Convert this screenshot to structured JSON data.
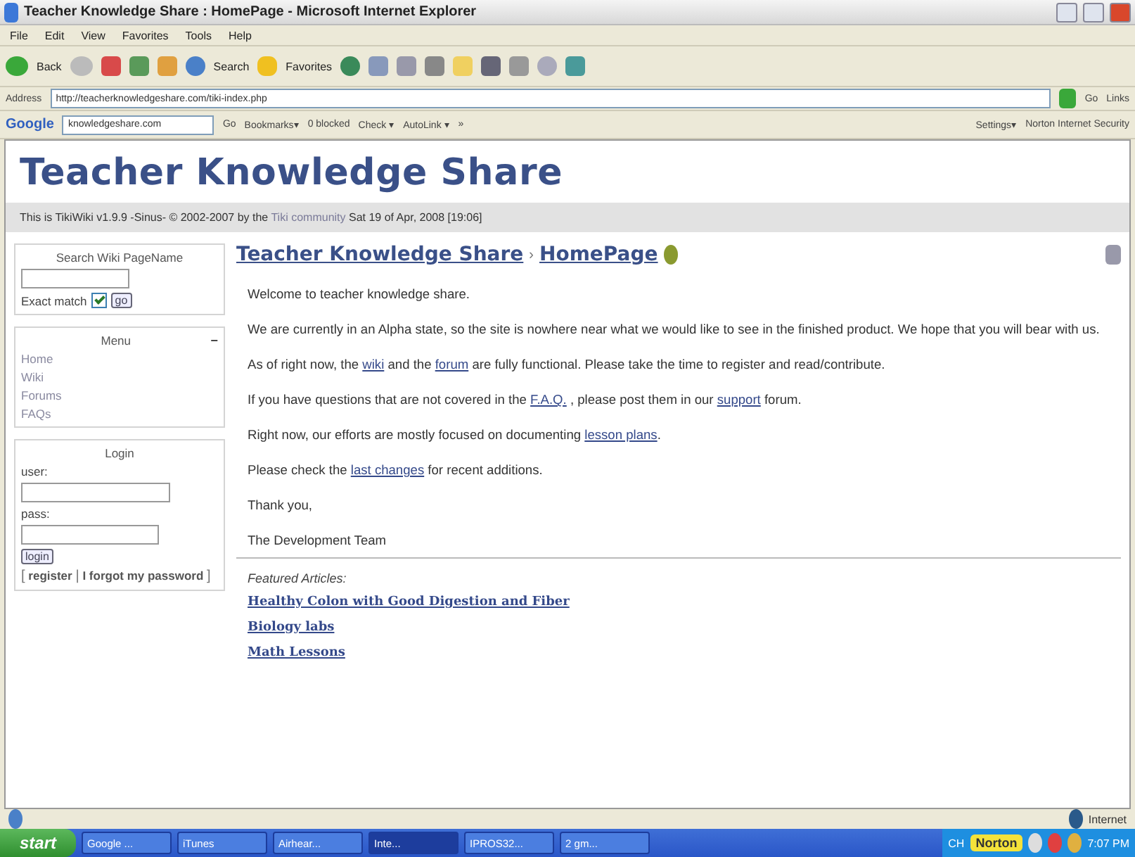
{
  "window": {
    "title": "Teacher Knowledge Share : HomePage - Microsoft Internet Explorer"
  },
  "menu_bar": [
    "File",
    "Edit",
    "View",
    "Favorites",
    "Tools",
    "Help"
  ],
  "toolbar": {
    "back": "Back",
    "search": "Search",
    "favorites": "Favorites"
  },
  "address_bar": {
    "label": "Address",
    "url": "http://teacherknowledgeshare.com/tiki-index.php",
    "go": "Go",
    "links": "Links"
  },
  "google_bar": {
    "logo": "Google",
    "search_value": "knowledgeshare.com",
    "go": "Go",
    "bookmarks": "Bookmarks▾",
    "blocked": "0 blocked",
    "check": "Check ▾",
    "autolink": "AutoLink ▾",
    "more": "»",
    "settings": "Settings▾",
    "norton": "Norton Internet Security"
  },
  "site": {
    "title": "Teacher Knowledge Share",
    "tagline_before": "This is TikiWiki v1.9.9 -Sinus- © 2002-2007 by the",
    "tagline_link": "Tiki community",
    "tagline_after": "Sat 19 of Apr, 2008 [19:06]"
  },
  "search_box": {
    "title": "Search Wiki PageName",
    "exact_match": "Exact match",
    "checked": true,
    "go": "go"
  },
  "menu_box": {
    "title": "Menu",
    "collapse": "−",
    "items": [
      "Home",
      "Wiki",
      "Forums",
      "FAQs"
    ]
  },
  "login_box": {
    "title": "Login",
    "user_label": "user:",
    "pass_label": "pass:",
    "button": "login",
    "open_bracket": "[",
    "register": "register",
    "divider": "|",
    "forgot": "I forgot my password",
    "close_bracket": "]"
  },
  "page": {
    "breadcrumb": "Teacher Knowledge Share",
    "separator": "›",
    "page_name": "HomePage",
    "paragraphs": [
      [
        {
          "kind": "text",
          "text": "Welcome to teacher knowledge share."
        }
      ],
      [
        {
          "kind": "text",
          "text": "We are currently in an Alpha state, so the site is nowhere near what we would like to see in the finished product. We hope that you will bear with us."
        }
      ],
      [
        {
          "kind": "text",
          "text": "As of right now, the "
        },
        {
          "kind": "link",
          "text": "wiki"
        },
        {
          "kind": "text",
          "text": " and the "
        },
        {
          "kind": "link",
          "text": "forum"
        },
        {
          "kind": "text",
          "text": " are fully functional. Please take the time to register and read/contribute."
        }
      ],
      [
        {
          "kind": "text",
          "text": "If you have questions that are not covered in the "
        },
        {
          "kind": "link",
          "text": "F.A.Q."
        },
        {
          "kind": "text",
          "text": " , please post them in our "
        },
        {
          "kind": "link",
          "text": "support"
        },
        {
          "kind": "text",
          "text": " forum."
        }
      ],
      [
        {
          "kind": "text",
          "text": "Right now, our efforts are mostly focused on documenting "
        },
        {
          "kind": "link",
          "text": "lesson plans"
        },
        {
          "kind": "text",
          "text": "."
        }
      ],
      [
        {
          "kind": "text",
          "text": "Please check the "
        },
        {
          "kind": "link",
          "text": "last changes"
        },
        {
          "kind": "text",
          "text": " for recent additions."
        }
      ],
      [
        {
          "kind": "text",
          "text": "Thank you,"
        }
      ],
      [
        {
          "kind": "text",
          "text": "The Development Team"
        }
      ]
    ],
    "featured_label": "Featured Articles:",
    "featured": [
      "Healthy Colon with Good Digestion and Fiber",
      "Biology labs",
      "Math Lessons"
    ]
  },
  "status_bar": {
    "zone": "Internet"
  },
  "taskbar": {
    "start": "start",
    "tasks": [
      {
        "label": "Google ...",
        "selected": false
      },
      {
        "label": "iTunes",
        "selected": false
      },
      {
        "label": "Airhear...",
        "selected": false
      },
      {
        "label": "Inte...",
        "selected": true
      },
      {
        "label": "IPROS32...",
        "selected": false
      },
      {
        "label": "2 gm...",
        "selected": false
      }
    ],
    "language": "CH",
    "norton": "Norton",
    "clock": "7:07 PM"
  }
}
